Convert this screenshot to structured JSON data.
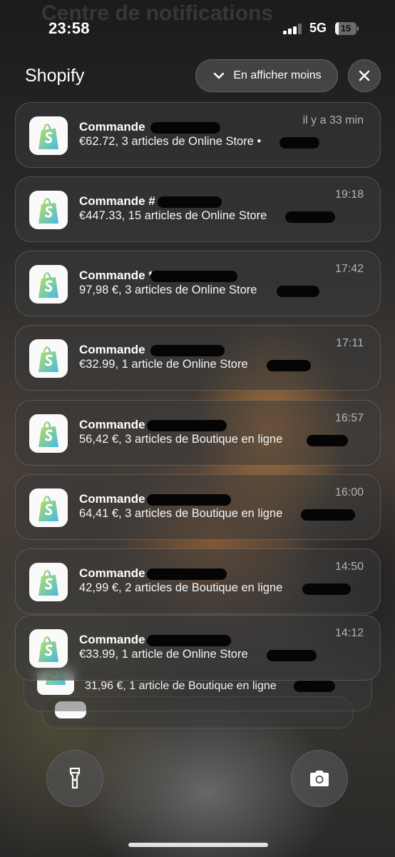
{
  "background_title": "Centre de notifications",
  "status_bar": {
    "time": "23:58",
    "network": "5G",
    "battery_level": "15",
    "battery_fraction": 0.15
  },
  "group": {
    "app_name": "Shopify",
    "show_less_label": "En afficher moins",
    "show_less_icon": "chevron-down-icon",
    "clear_icon": "close-icon"
  },
  "notifications": [
    {
      "title": "Commande",
      "body": "€62.72, 3 articles de Online Store •",
      "time": "il y a 33 min"
    },
    {
      "title": "Commande #",
      "body": "€447.33, 15 articles de Online Store",
      "time": "19:18"
    },
    {
      "title": "Commande *",
      "body": "97,98 €, 3 articles de Online Store",
      "time": "17:42"
    },
    {
      "title": "Commande",
      "body": "€32.99, 1 article de Online Store",
      "time": "17:11"
    },
    {
      "title": "Commande",
      "body": "56,42 €, 3 articles de Boutique en ligne",
      "time": "16:57"
    },
    {
      "title": "Commande",
      "body": "64,41 €, 3 articles de Boutique en ligne",
      "time": "16:00"
    },
    {
      "title": "Commande",
      "body": "42,99 €, 2 articles de Boutique en ligne",
      "time": "14:50"
    },
    {
      "title": "Commande",
      "body": "€33.99, 1 article de Online Store",
      "time": "14:12"
    }
  ],
  "stacked": [
    {
      "body": "31,96 €, 1 article de Boutique en ligne"
    }
  ],
  "lockscreen_buttons": {
    "left_icon": "flashlight-icon",
    "right_icon": "camera-icon"
  },
  "colors": {
    "shopify_green": "#95BF47",
    "shopify_blue": "#5EC9E6"
  }
}
